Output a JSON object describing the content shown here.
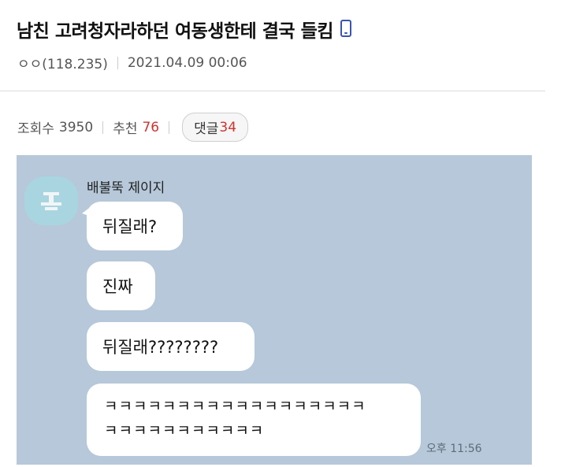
{
  "post": {
    "title": "남친 고려청자라하던 여동생한테 결국 들킴",
    "author": "ㅇㅇ(118.235)",
    "date": "2021.04.09 00:06",
    "views_label": "조회수",
    "views": "3950",
    "recommend_label": "추천",
    "recommend": "76",
    "comments_label": "댓글",
    "comments": "34",
    "mobile_icon": "mobile-phone-icon"
  },
  "chat": {
    "background": "#b6c8d9",
    "sender": "배불뚝 제이지",
    "messages": [
      "뒤질래?",
      "진짜",
      "뒤질래????????"
    ],
    "long_message_line1": "ㅋㅋㅋㅋㅋㅋㅋㅋㅋㅋㅋㅋㅋㅋㅋㅋㅋㅋ",
    "long_message_line2": "ㅋㅋㅋㅋㅋㅋㅋㅋㅋㅋㅋ",
    "time": "오후 11:56"
  },
  "colors": {
    "accent_red": "#d0332e",
    "icon_blue": "#3a55b0"
  }
}
